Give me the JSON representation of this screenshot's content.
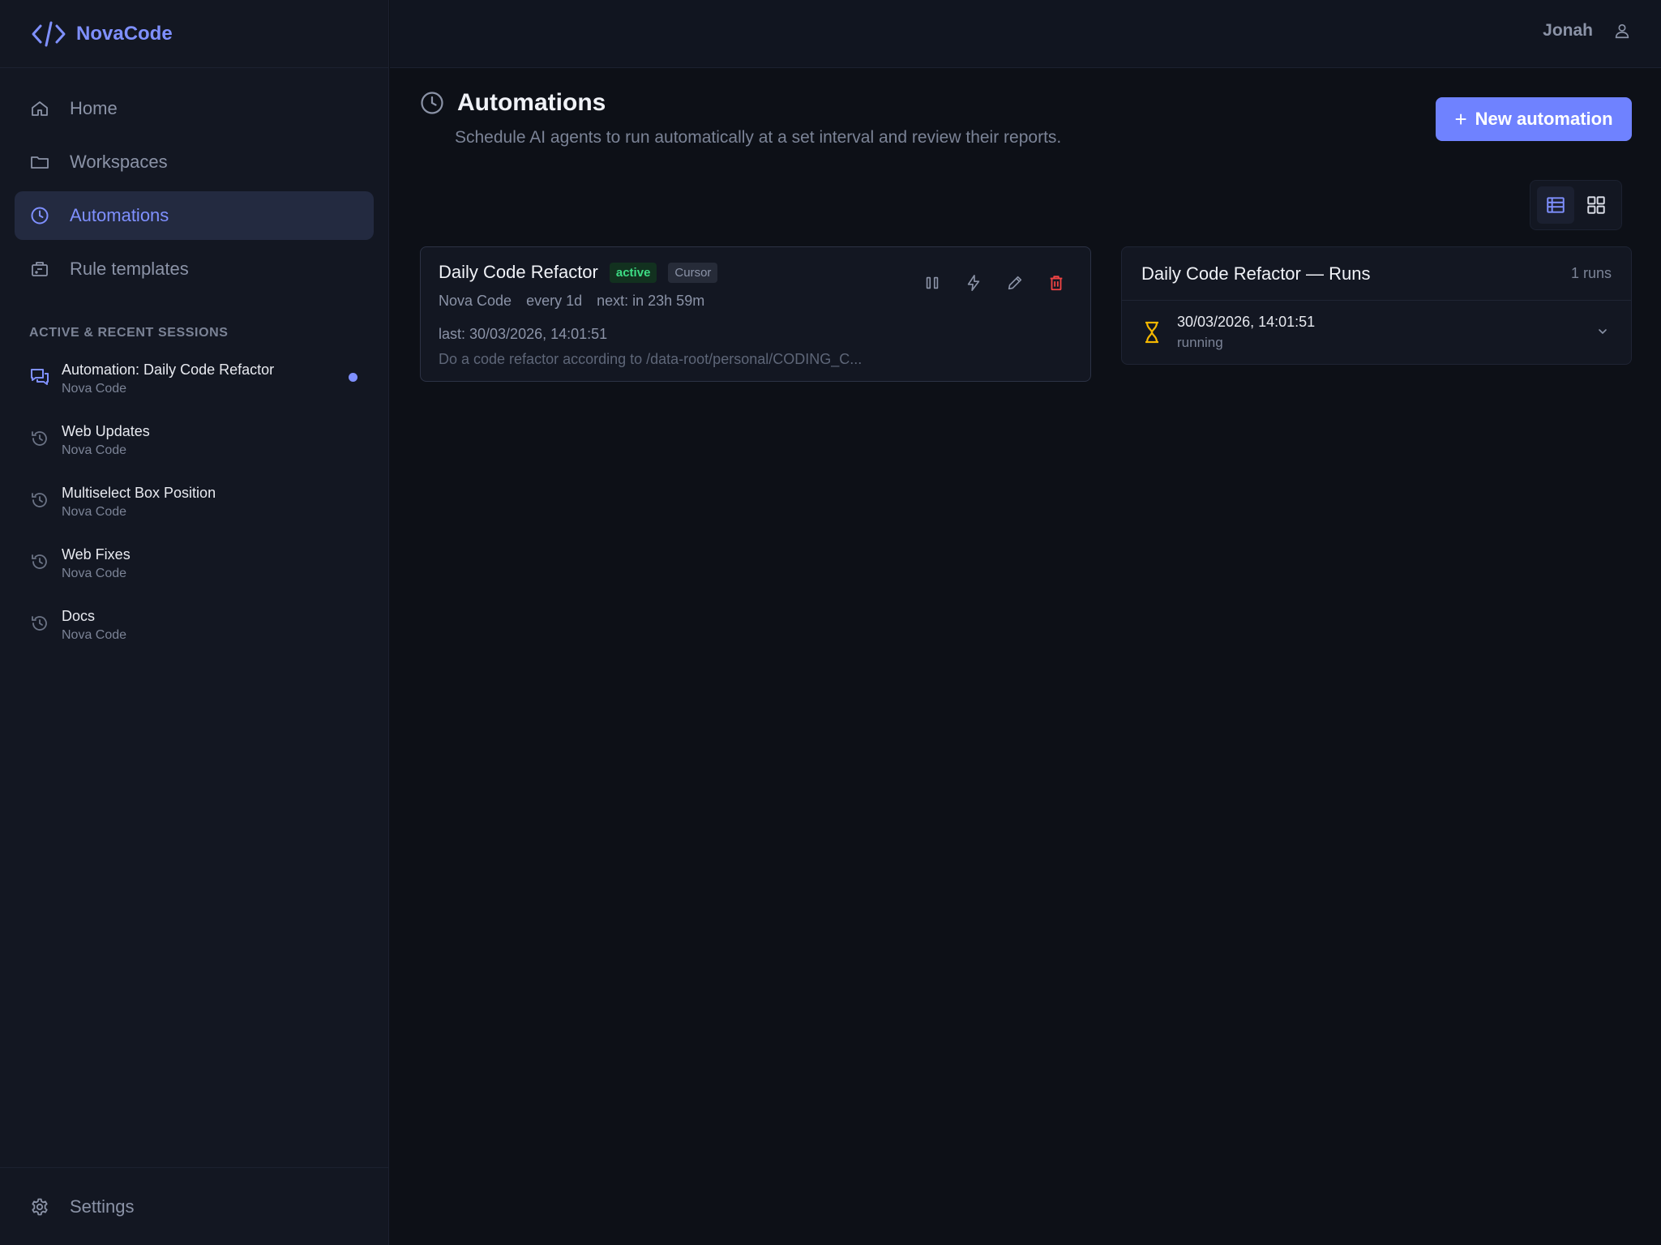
{
  "brand": {
    "name": "NovaCode",
    "accent": "#7f90ff"
  },
  "nav": {
    "items": [
      {
        "label": "Home",
        "icon": "home-icon"
      },
      {
        "label": "Workspaces",
        "icon": "folder-icon"
      },
      {
        "label": "Automations",
        "icon": "clock-icon",
        "active": true
      },
      {
        "label": "Rule templates",
        "icon": "briefcase-icon"
      }
    ]
  },
  "sessions": {
    "title": "ACTIVE & RECENT SESSIONS",
    "items": [
      {
        "title": "Automation: Daily Code Refactor",
        "sub": "Nova Code",
        "icon": "chat-icon",
        "live": true
      },
      {
        "title": "Web Updates",
        "sub": "Nova Code",
        "icon": "history-icon"
      },
      {
        "title": "Multiselect Box Position",
        "sub": "Nova Code",
        "icon": "history-icon"
      },
      {
        "title": "Web Fixes",
        "sub": "Nova Code",
        "icon": "history-icon"
      },
      {
        "title": "Docs",
        "sub": "Nova Code",
        "icon": "history-icon"
      }
    ]
  },
  "settings": {
    "label": "Settings",
    "icon": "gear-icon"
  },
  "topbar": {
    "user": "Jonah",
    "icon": "user-icon"
  },
  "page": {
    "title": "Automations",
    "subtitle": "Schedule AI agents to run automatically at a set interval and review their reports.",
    "new_button": "New automation"
  },
  "view_toggle": {
    "options": [
      "list-view-icon",
      "grid-view-icon"
    ],
    "selected": "list-view-icon"
  },
  "automation": {
    "title": "Daily Code Refactor",
    "status": "active",
    "agent": "Cursor",
    "workspace": "Nova Code",
    "interval": "every 1d",
    "next": "next: in 23h 59m",
    "last": "last: 30/03/2026, 14:01:51",
    "description": "Do a code refactor according to /data-root/personal/CODING_C...",
    "actions": [
      "pause-icon",
      "run-now-icon",
      "edit-icon",
      "delete-icon"
    ]
  },
  "runs": {
    "title": "Daily Code Refactor — Runs",
    "count": "1 runs",
    "items": [
      {
        "time": "30/03/2026, 14:01:51",
        "status": "running",
        "icon": "hourglass-icon"
      }
    ]
  },
  "colors": {
    "primary_button": "#6f82ff",
    "active_badge": "#3ddc84",
    "delete": "#ef4444",
    "running": "#f5b700"
  }
}
